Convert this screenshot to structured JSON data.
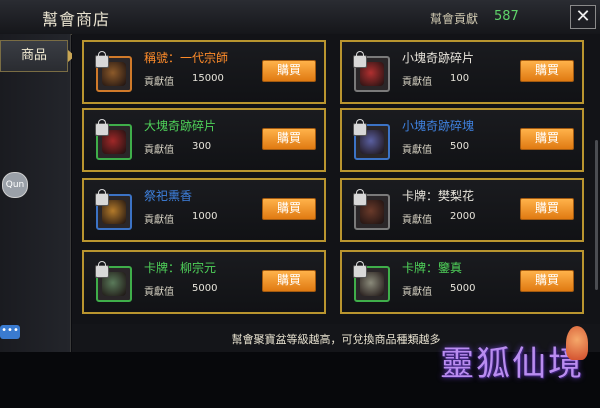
{
  "header": {
    "title": "幫會商店",
    "contribution_label": "幫會貢獻",
    "contribution_value": "587",
    "close_label": "✕"
  },
  "sidebar": {
    "tab_label": "商品"
  },
  "floating_icon_text": "Qun",
  "chat_icon_text": "•••",
  "items": [
    {
      "name": "稱號：一代宗師",
      "cost_label": "貢獻值",
      "cost": "15000",
      "buy_label": "購買",
      "name_color": "#ff8c2a",
      "frame": "orange",
      "art_color": "#8c5a2a",
      "locked": true
    },
    {
      "name": "小塊奇跡碎片",
      "cost_label": "貢獻值",
      "cost": "100",
      "buy_label": "購買",
      "name_color": "#e8e5dc",
      "frame": "gray",
      "art_color": "#b03030",
      "locked": true
    },
    {
      "name": "大塊奇跡碎片",
      "cost_label": "貢獻值",
      "cost": "300",
      "buy_label": "購買",
      "name_color": "#4fd35a",
      "frame": "green",
      "art_color": "#a02828",
      "locked": true
    },
    {
      "name": "小塊奇跡碎塊",
      "cost_label": "貢獻值",
      "cost": "500",
      "buy_label": "購買",
      "name_color": "#3f82e0",
      "frame": "blue",
      "art_color": "#5a5fa0",
      "locked": true
    },
    {
      "name": "祭祀熏香",
      "cost_label": "貢獻值",
      "cost": "1000",
      "buy_label": "購買",
      "name_color": "#3f82e0",
      "frame": "blue",
      "art_color": "#b37a2a",
      "locked": true
    },
    {
      "name": "卡牌：樊梨花",
      "cost_label": "貢獻值",
      "cost": "2000",
      "buy_label": "購買",
      "name_color": "#e8e5dc",
      "frame": "gray",
      "art_color": "#6a3a2a",
      "locked": true
    },
    {
      "name": "卡牌：柳宗元",
      "cost_label": "貢獻值",
      "cost": "5000",
      "buy_label": "購買",
      "name_color": "#4fd35a",
      "frame": "green",
      "art_color": "#5a7a5a",
      "locked": true
    },
    {
      "name": "卡牌：鑒真",
      "cost_label": "貢獻值",
      "cost": "5000",
      "buy_label": "購買",
      "name_color": "#4fd35a",
      "frame": "green",
      "art_color": "#8a8a7a",
      "locked": true
    }
  ],
  "footer_text": "幫會聚寶盆等級越高，可兌換商品種類越多",
  "logo_text": "靈狐仙境"
}
